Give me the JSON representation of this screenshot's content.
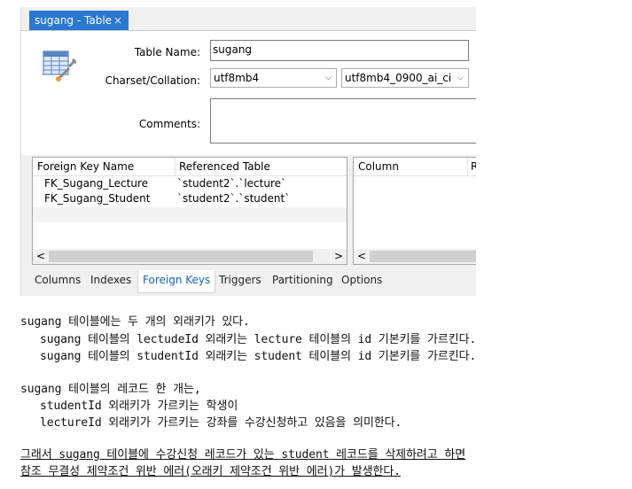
{
  "window": {
    "tab_title": "sugang - Table",
    "tab_close": "×"
  },
  "form": {
    "table_name_label": "Table Name:",
    "table_name_value": "sugang",
    "charset_label": "Charset/Collation:",
    "charset_value": "utf8mb4",
    "collation_value": "utf8mb4_0900_ai_ci",
    "comments_label": "Comments:",
    "comments_value": "",
    "icon": "table-wrench-icon"
  },
  "foreign_keys": {
    "columns": [
      "Foreign Key Name",
      "Referenced Table"
    ],
    "rows": [
      {
        "name": "FK_Sugang_Lecture",
        "ref": "`student2`.`lecture`"
      },
      {
        "name": "FK_Sugang_Student",
        "ref": "`student2`.`student`"
      }
    ]
  },
  "column_panel": {
    "columns": [
      "Column",
      "R"
    ]
  },
  "scroll": {
    "left": "<",
    "right": ">"
  },
  "bottom_tabs": [
    {
      "label": "Columns"
    },
    {
      "label": "Indexes"
    },
    {
      "label": "Foreign Keys",
      "active": true
    },
    {
      "label": "Triggers"
    },
    {
      "label": "Partitioning"
    },
    {
      "label": "Options"
    }
  ],
  "text": {
    "line1": "sugang 테이블에는 두 개의 외래키가 있다.",
    "line2": "sugang 테이블의 lectudeId 외래키는 lecture 테이블의 id 기본키를 가르킨다.",
    "line3": "sugang 테이블의 studentId 외래키는 student 테이블의 id 기본키를 가르킨다.",
    "line4": "sugang 테이블의 레코드 한 개는,",
    "line5": "studentId 외래키가 가르키는 학생이",
    "line6": "lectureId 외래키가 가르키는 강좌를 수강신청하고 있음을 의미한다.",
    "line7": "그래서 sugang 테이블에 수강신청 레코드가 있는 student 레코드를 삭제하려고 하면",
    "line8": "참조 무결성 제약조건 위반 에러(오래키 제약조건 위반 에러)가 발생한다."
  },
  "colors": {
    "tab_active": "#2a78cf",
    "tab_link": "#1d5fb5"
  }
}
